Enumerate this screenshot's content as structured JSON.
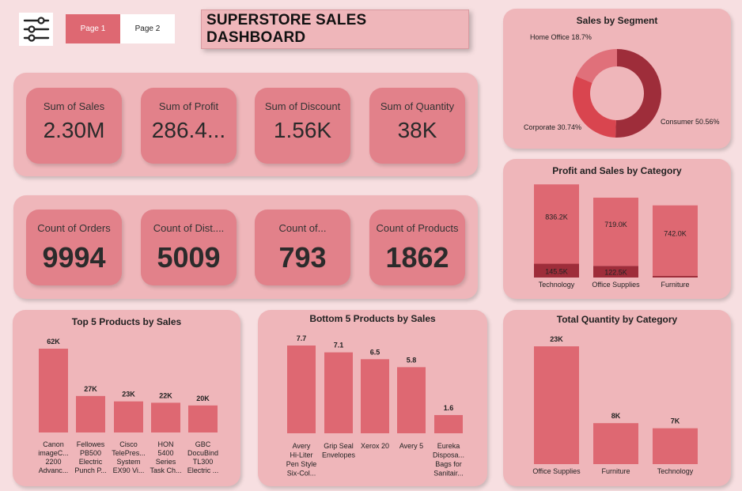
{
  "header": {
    "pages": [
      "Page 1",
      "Page 2"
    ],
    "title": "SUPERSTORE SALES DASHBOARD"
  },
  "kpis_row1": [
    {
      "label": "Sum of Sales",
      "value": "2.30M"
    },
    {
      "label": "Sum of Profit",
      "value": "286.4..."
    },
    {
      "label": "Sum of Discount",
      "value": "1.56K"
    },
    {
      "label": "Sum of Quantity",
      "value": "38K"
    }
  ],
  "kpis_row2": [
    {
      "label": "Count of Orders",
      "value": "9994"
    },
    {
      "label": "Count of Dist....",
      "value": "5009"
    },
    {
      "label": "Count of...",
      "value": "793"
    },
    {
      "label": "Count of Products",
      "value": "1862"
    }
  ],
  "colors": {
    "bar": "#de6872",
    "dark": "#9e2d3a",
    "mid": "#d9454f",
    "panel": "#efb6ba"
  },
  "chart_data": [
    {
      "id": "segment",
      "type": "pie",
      "title": "Sales by Segment",
      "slices": [
        {
          "label": "Consumer 50.56%",
          "value": 50.56,
          "color": "#9e2d3a"
        },
        {
          "label": "Corporate 30.74%",
          "value": 30.74,
          "color": "#d9454f"
        },
        {
          "label": "Home Office 18.7%",
          "value": 18.7,
          "color": "#e0707a"
        }
      ]
    },
    {
      "id": "profit_sales",
      "type": "bar",
      "title": "Profit and Sales by Category",
      "categories": [
        "Technology",
        "Office Supplies",
        "Furniture"
      ],
      "series": [
        {
          "values": [
            145.5,
            122.5,
            18.5
          ],
          "labels": [
            "145.5K",
            "122.5K",
            ""
          ],
          "color": "#9e2d3a"
        },
        {
          "values": [
            836.2,
            719.0,
            742.0
          ],
          "labels": [
            "836.2K",
            "719.0K",
            "742.0K"
          ],
          "color": "#de6872"
        }
      ],
      "ylim": [
        0,
        1000
      ]
    },
    {
      "id": "top5",
      "type": "bar",
      "title": "Top 5 Products by Sales",
      "categories": [
        [
          "Canon",
          "imageC...",
          "2200",
          "Advanc..."
        ],
        [
          "Fellowes",
          "PB500",
          "Electric",
          "Punch P..."
        ],
        [
          "Cisco",
          "TelePres...",
          "System",
          "EX90 Vi..."
        ],
        [
          "HON",
          "5400",
          "Series",
          "Task Ch..."
        ],
        [
          "GBC",
          "DocuBind",
          "TL300",
          "Electric ..."
        ]
      ],
      "values": [
        62,
        27,
        23,
        22,
        20
      ],
      "labels": [
        "62K",
        "27K",
        "23K",
        "22K",
        "20K"
      ],
      "ylim": [
        0,
        62
      ]
    },
    {
      "id": "bottom5",
      "type": "bar",
      "title": "Bottom 5 Products by Sales",
      "categories": [
        [
          "Avery",
          "Hi-Liter",
          "Pen Style",
          "Six-Col..."
        ],
        [
          "Grip Seal",
          "Envelopes"
        ],
        [
          "Xerox 20"
        ],
        [
          "Avery 5"
        ],
        [
          "Eureka",
          "Disposa...",
          "Bags for",
          "Sanitair..."
        ]
      ],
      "values": [
        7.7,
        7.1,
        6.5,
        5.8,
        1.6
      ],
      "labels": [
        "7.7",
        "7.1",
        "6.5",
        "5.8",
        "1.6"
      ],
      "ylim": [
        0,
        7.7
      ]
    },
    {
      "id": "quantity",
      "type": "bar",
      "title": "Total Quantity by Category",
      "categories": [
        "Office Supplies",
        "Furniture",
        "Technology"
      ],
      "values": [
        23,
        8,
        7
      ],
      "labels": [
        "23K",
        "8K",
        "7K"
      ],
      "ylim": [
        0,
        23
      ]
    }
  ]
}
